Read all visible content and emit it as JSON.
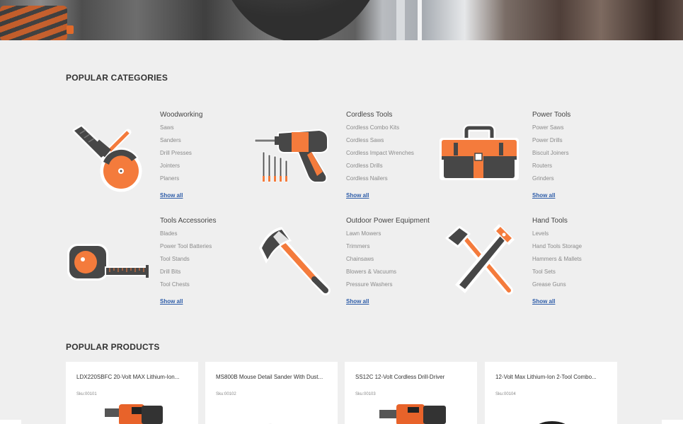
{
  "colors": {
    "accent": "#f47b3c",
    "dark": "#474747",
    "link": "#2d5ca8",
    "background": "#efefef"
  },
  "categories_section": {
    "title": "POPULAR CATEGORIES",
    "items": [
      {
        "title": "Woodworking",
        "icon": "angle-grinder-icon",
        "links": [
          "Saws",
          "Sanders",
          "Drill Presses",
          "Jointers",
          "Planers"
        ],
        "show_all": "Show all"
      },
      {
        "title": "Cordless Tools",
        "icon": "drill-with-bits-icon",
        "links": [
          "Cordless Combo Kits",
          "Cordless Saws",
          "Cordless Impact Wrenches",
          "Cordless Drills",
          "Cordless Nailers"
        ],
        "show_all": "Show all"
      },
      {
        "title": "Power Tools",
        "icon": "toolbox-icon",
        "links": [
          "Power Saws",
          "Power Drills",
          "Biscuit Joiners",
          "Routers",
          "Grinders"
        ],
        "show_all": "Show all"
      },
      {
        "title": "Tools Accessories",
        "icon": "tape-measure-icon",
        "links": [
          "Blades",
          "Power Tool Batteries",
          "Tool Stands",
          "Drill Bits",
          "Tool Chests"
        ],
        "show_all": "Show all"
      },
      {
        "title": "Outdoor Power Equipment",
        "icon": "axe-icon",
        "links": [
          "Lawn Mowers",
          "Trimmers",
          "Chainsaws",
          "Blowers & Vacuums",
          "Pressure Washers"
        ],
        "show_all": "Show all"
      },
      {
        "title": "Hand Tools",
        "icon": "hammer-saw-icon",
        "links": [
          "Levels",
          "Hand Tools Storage",
          "Hammers & Mallets",
          "Tool Sets",
          "Grease Guns"
        ],
        "show_all": "Show all"
      }
    ]
  },
  "products_section": {
    "title": "POPULAR PRODUCTS",
    "items": [
      {
        "name": "LDX220SBFC 20-Volt MAX Lithium-Ion...",
        "sku": "Sku:00101",
        "image": "cordless-drill-image"
      },
      {
        "name": "MS800B Mouse Detail Sander With Dust...",
        "sku": "Sku:00102",
        "image": "detail-sander-image"
      },
      {
        "name": "SS12C 12-Volt Cordless Drill-Driver",
        "sku": "Sku:00103",
        "image": "drill-driver-image"
      },
      {
        "name": "12-Volt Max Lithium-Ion 2-Tool Combo...",
        "sku": "Sku:00104",
        "image": "combo-kit-image"
      }
    ]
  }
}
